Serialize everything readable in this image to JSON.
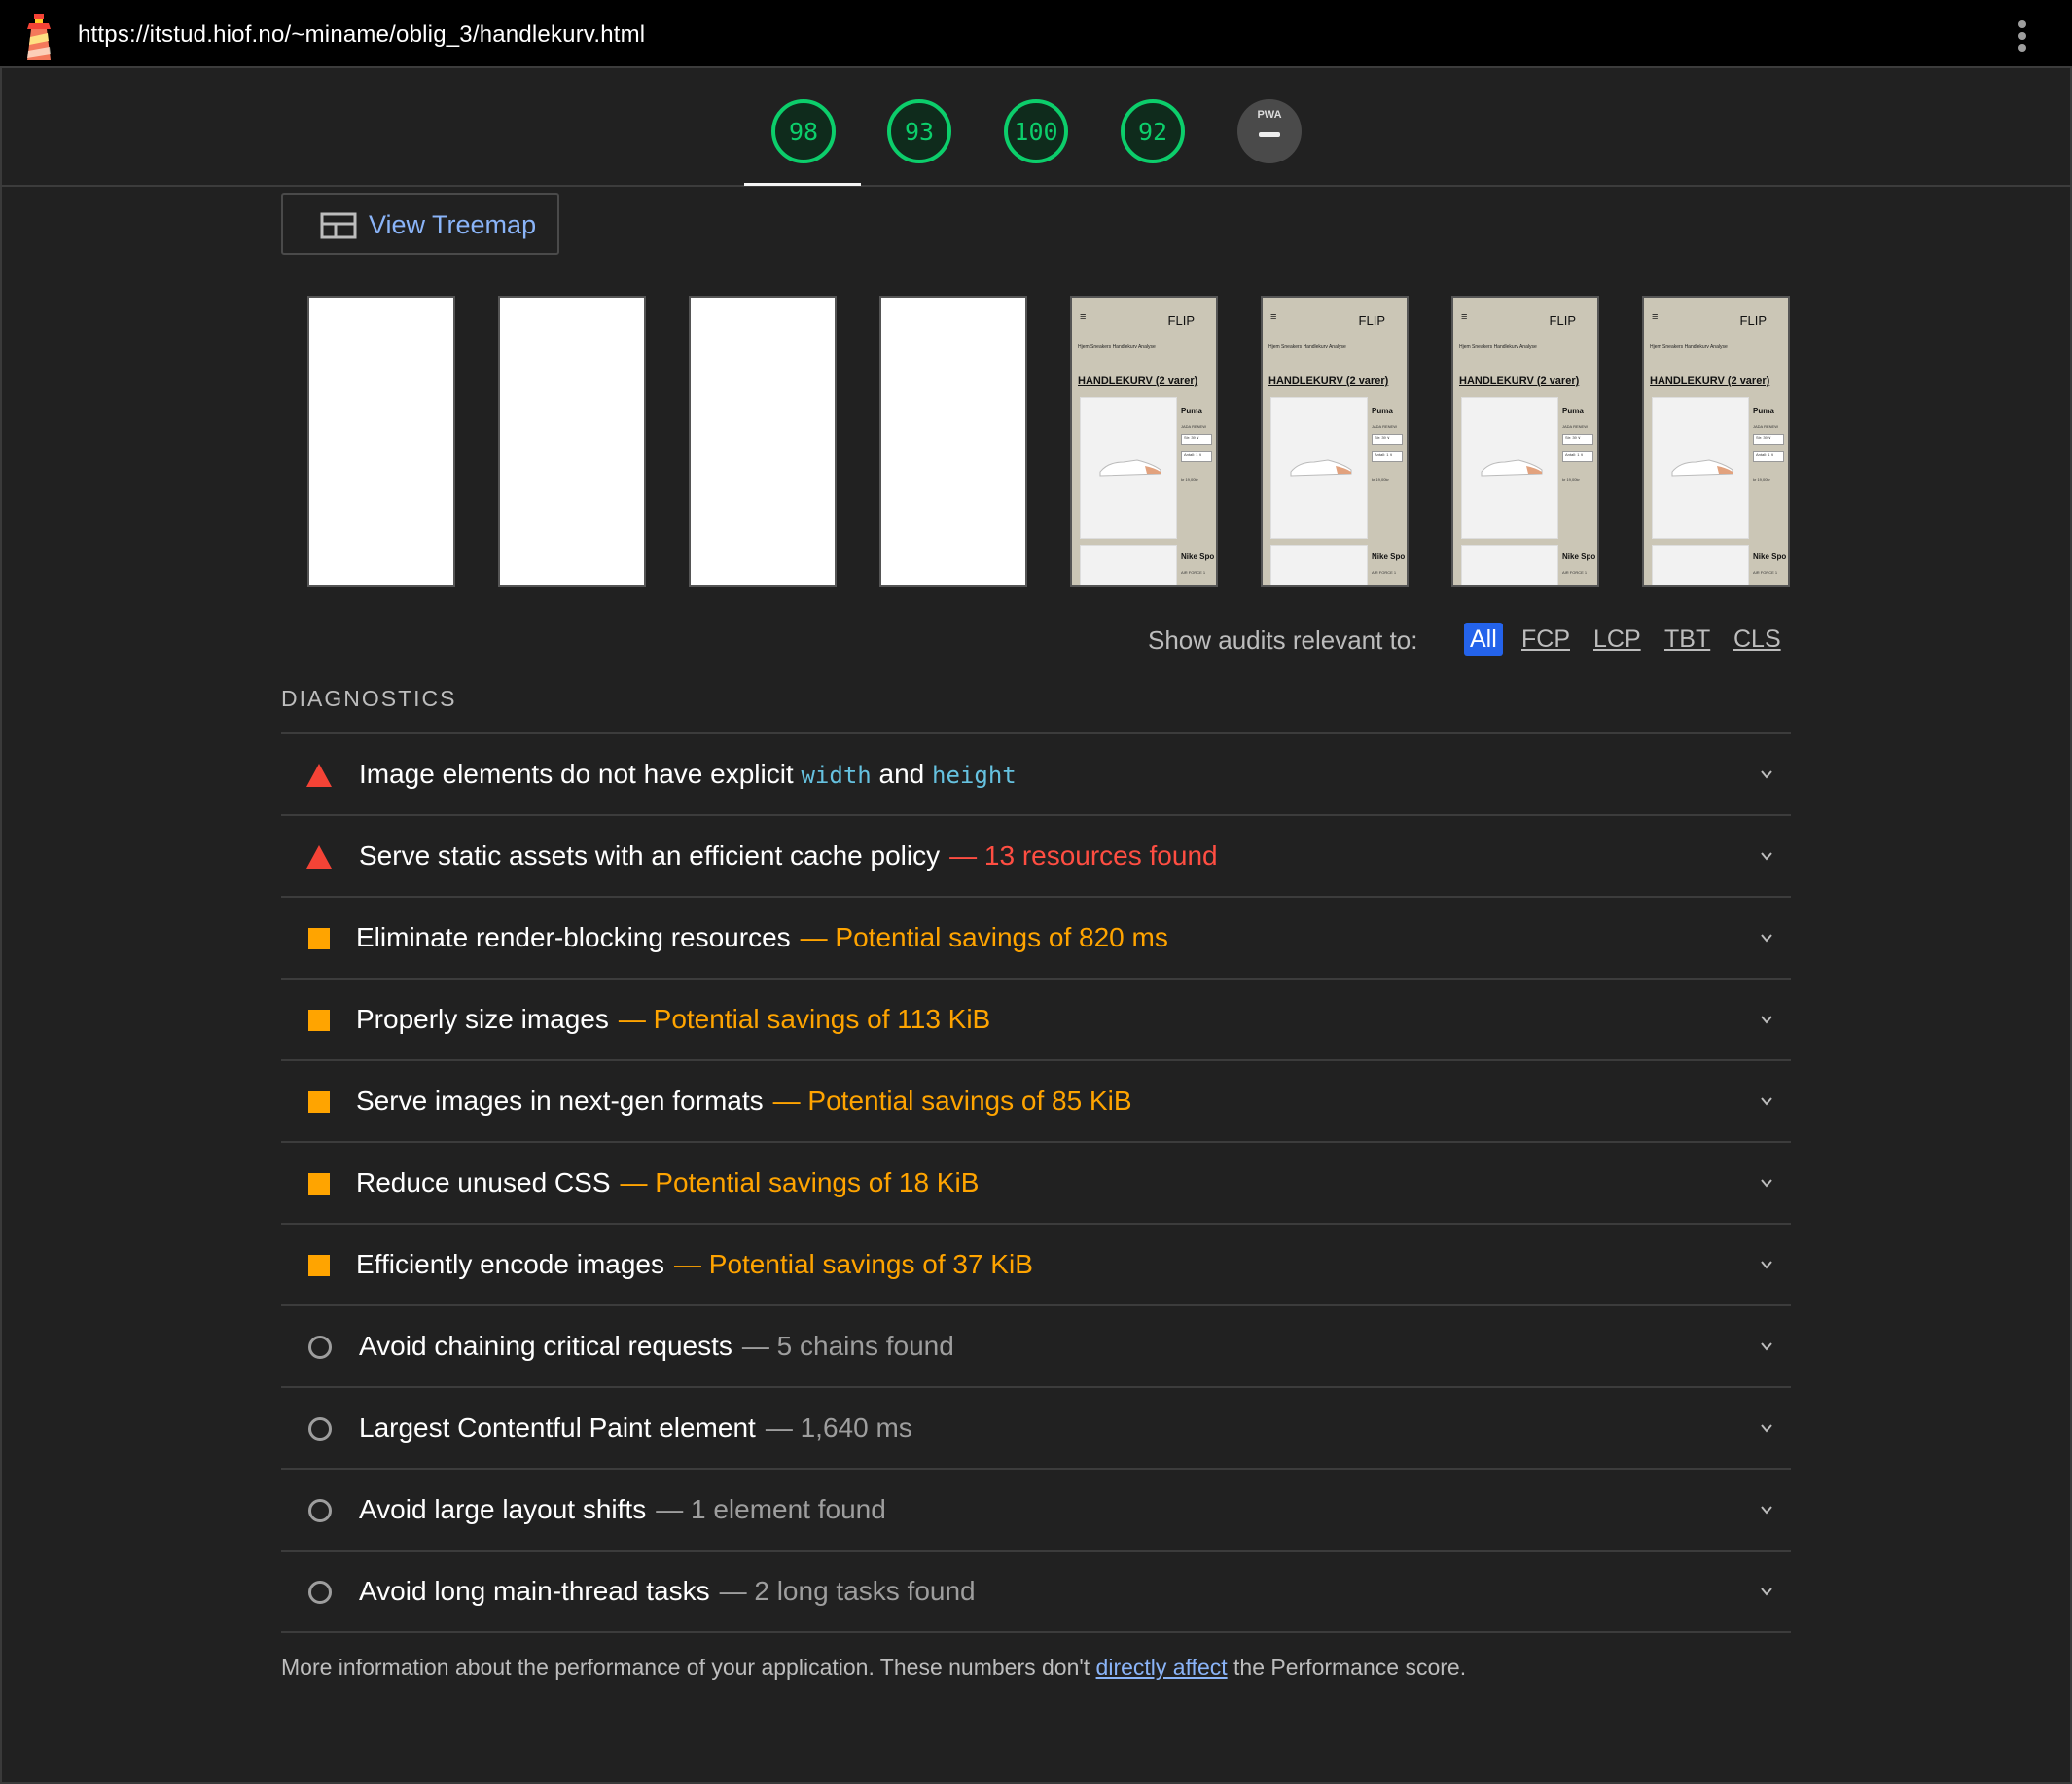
{
  "browser": {
    "url": "https://itstud.hiof.no/~miname/oblig_3/handlekurv.html"
  },
  "scores": [
    {
      "category": "performance",
      "value": "98"
    },
    {
      "category": "accessibility",
      "value": "93"
    },
    {
      "category": "best-practices",
      "value": "100"
    },
    {
      "category": "seo",
      "value": "92"
    }
  ],
  "pwa": {
    "label": "PWA"
  },
  "treemap": {
    "label": "View Treemap",
    "icon": "treemap-icon"
  },
  "filmstrip": {
    "blank_frames": 4,
    "page_frames": [
      {
        "logo": "FLIP",
        "menu": "≡",
        "nav": "Hjem  Sneakers  Handlekurv  Analyse",
        "title": "HANDLEKURV (2 varer)",
        "brand1": "Puma",
        "detail1": "JADA RENEW",
        "size1": "Str: 39 ∨",
        "qty1": "Antall: 1 ∨",
        "price1": "kr 19,00kr",
        "brand2": "Nike Spo",
        "sub2": "AIR FORCE 1"
      },
      {
        "logo": "FLIP",
        "menu": "≡",
        "nav": "Hjem  Sneakers  Handlekurv  Analyse",
        "title": "HANDLEKURV (2 varer)",
        "brand1": "Puma",
        "detail1": "JADA RENEW",
        "size1": "Str: 39 ∨",
        "qty1": "Antall: 1 ∨",
        "price1": "kr 19,00kr",
        "brand2": "Nike Spo",
        "sub2": "AIR FORCE 1"
      },
      {
        "logo": "FLIP",
        "menu": "≡",
        "nav": "Hjem  Sneakers  Handlekurv  Analyse",
        "title": "HANDLEKURV (2 varer)",
        "brand1": "Puma",
        "detail1": "JADA RENEW",
        "size1": "Str: 39 ∨",
        "qty1": "Antall: 1 ∨",
        "price1": "kr 19,00kr",
        "brand2": "Nike Spo",
        "sub2": "AIR FORCE 1"
      },
      {
        "logo": "FLIP",
        "menu": "≡",
        "nav": "Hjem  Sneakers  Handlekurv  Analyse",
        "title": "HANDLEKURV (2 varer)",
        "brand1": "Puma",
        "detail1": "JADA RENEW",
        "size1": "Str: 39 ∨",
        "qty1": "Antall: 1 ∨",
        "price1": "kr 19,00kr",
        "brand2": "Nike Spo",
        "sub2": "AIR FORCE 1"
      }
    ]
  },
  "filter": {
    "label": "Show audits relevant to:",
    "options": [
      "All",
      "FCP",
      "LCP",
      "TBT",
      "CLS"
    ],
    "active": "All"
  },
  "diagnostics": {
    "title": "DIAGNOSTICS",
    "audits": [
      {
        "severity": "fail",
        "title_pre": "Image elements do not have explicit ",
        "code1": "width",
        "title_mid": " and ",
        "code2": "height",
        "display": ""
      },
      {
        "severity": "fail",
        "title": "Serve static assets with an efficient cache policy",
        "display": "— 13 resources found"
      },
      {
        "severity": "average",
        "title": "Eliminate render-blocking resources",
        "display": "— Potential savings of 820 ms"
      },
      {
        "severity": "average",
        "title": "Properly size images",
        "display": "— Potential savings of 113 KiB"
      },
      {
        "severity": "average",
        "title": "Serve images in next-gen formats",
        "display": "— Potential savings of 85 KiB"
      },
      {
        "severity": "average",
        "title": "Reduce unused CSS",
        "display": "— Potential savings of 18 KiB"
      },
      {
        "severity": "average",
        "title": "Efficiently encode images",
        "display": "— Potential savings of 37 KiB"
      },
      {
        "severity": "info",
        "title": "Avoid chaining critical requests",
        "display": "— 5 chains found"
      },
      {
        "severity": "info",
        "title": "Largest Contentful Paint element",
        "display": "— 1,640 ms"
      },
      {
        "severity": "info",
        "title": "Avoid large layout shifts",
        "display": "— 1 element found"
      },
      {
        "severity": "info",
        "title": "Avoid long main-thread tasks",
        "display": "— 2 long tasks found"
      }
    ]
  },
  "footer": {
    "pre": "More information about the performance of your application. These numbers don't ",
    "link": "directly affect",
    "post": " the Performance score."
  },
  "colors": {
    "pass": "#0cce6b",
    "fail": "#ff4e42",
    "average": "#ffa400",
    "info": "#9e9e9e",
    "link": "#8ab4f8",
    "background": "#212121"
  }
}
